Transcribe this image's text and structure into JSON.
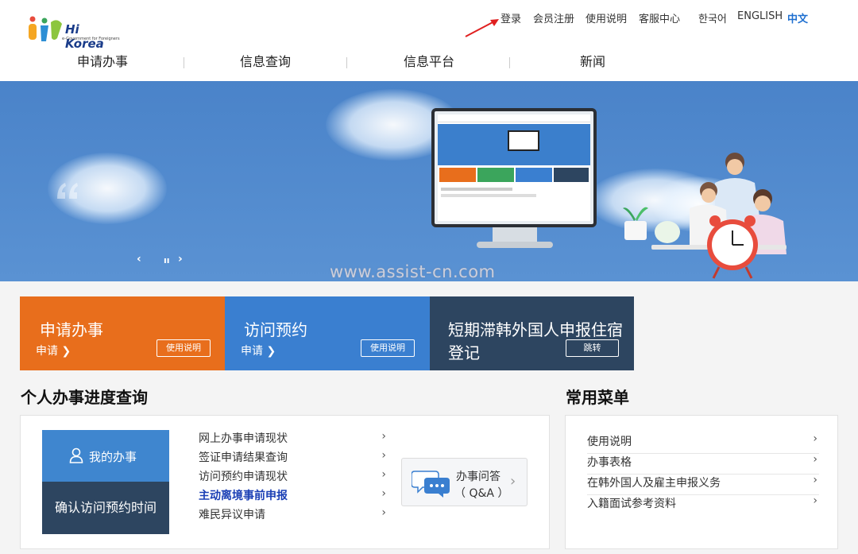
{
  "header": {
    "logo_text": "Hi Korea",
    "logo_sub": "e-Government for Foreigners",
    "util_links": [
      "登录",
      "会员注册",
      "使用说明",
      "客服中心"
    ],
    "lang_links": [
      "한국어",
      "ENGLISH",
      "中文"
    ],
    "nav": [
      "申请办事",
      "信息查询",
      "信息平台",
      "新闻"
    ]
  },
  "banner": {
    "prev": "‹",
    "pause": "ıı",
    "next": "›"
  },
  "watermark": "www.assist-cn.com",
  "tiles": [
    {
      "title": "申请办事",
      "sub": "申请 ❯",
      "button": "使用说明",
      "color": "#e86e1c"
    },
    {
      "title": "访问预约",
      "sub": "申请 ❯",
      "button": "使用说明",
      "color": "#3a7fd0"
    },
    {
      "title_line1": "短期滞韩外国人申报住宿",
      "title_line2": "登记",
      "button": "跳转",
      "color": "#2d4560"
    }
  ],
  "progress": {
    "title": "个人办事进度查询",
    "my_work": "我的办事",
    "confirm_visit": "确认访问预约时间",
    "links": [
      "网上办事申请现状",
      "签证申请结果查询",
      "访问预约申请现状",
      "主动离境事前申报",
      "难民异议申请"
    ],
    "qa_line1": "办事问答",
    "qa_line2": "（ Q&A ）"
  },
  "common_menu": {
    "title": "常用菜单",
    "items": [
      "使用说明",
      "办事表格",
      "在韩外国人及雇主申报义务",
      "入籍面试参考资料"
    ]
  },
  "chevron": "›"
}
